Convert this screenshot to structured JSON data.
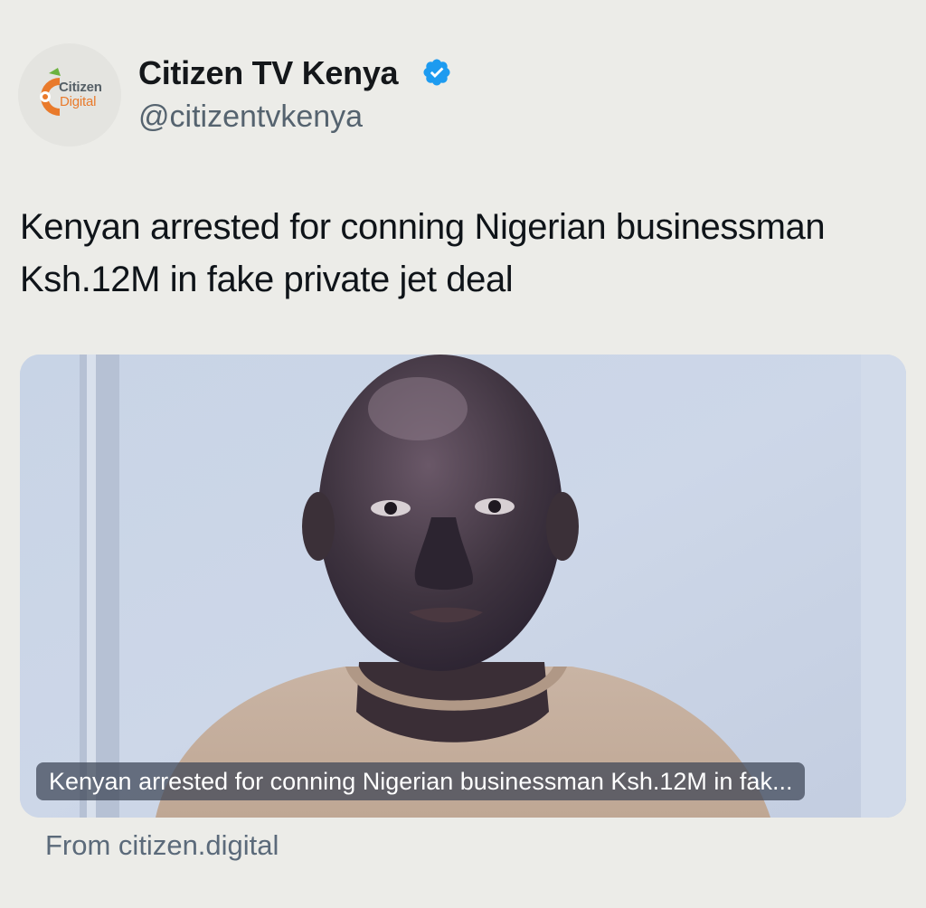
{
  "account": {
    "display_name": "Citizen TV Kenya",
    "handle": "@citizentvkenya",
    "verified": true,
    "avatar_icon": "citizen-digital-logo",
    "avatar_text_line1": "Citizen",
    "avatar_text_line2": "Digital"
  },
  "tweet": {
    "text": "Kenyan arrested for conning Nigerian businessman Ksh.12M in fake private jet deal"
  },
  "card": {
    "image": "photo-of-arrested-man",
    "caption": "Kenyan arrested for conning Nigerian businessman Ksh.12M in fak...",
    "source": "From citizen.digital"
  },
  "colors": {
    "background": "#ecece8",
    "verified_badge": "#1d9bf0",
    "brand_orange": "#e97a2b",
    "brand_green": "#6cb33f"
  }
}
